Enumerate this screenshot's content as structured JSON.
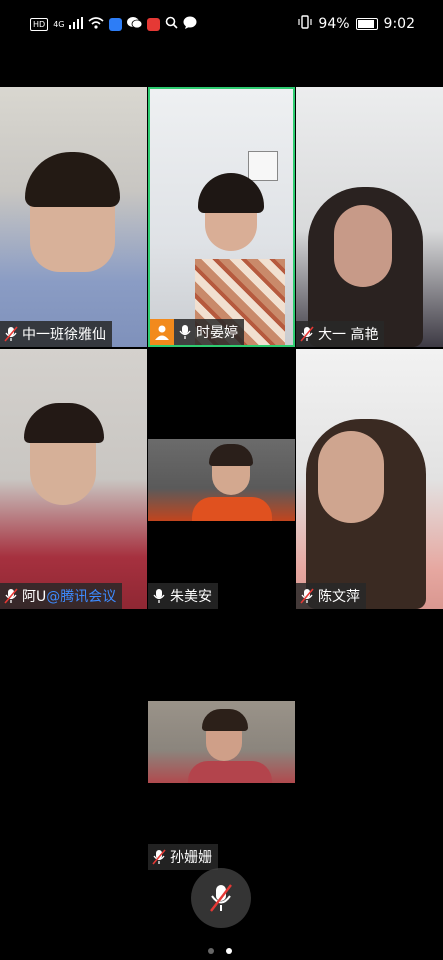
{
  "status_bar": {
    "hd": "HD",
    "net": "4G",
    "battery": "94%",
    "time": "9:02"
  },
  "participants": [
    {
      "name": "中一班徐雅仙",
      "mic": "muted"
    },
    {
      "name": "时晏婷",
      "mic": "on",
      "active_speaker": true
    },
    {
      "name": "大一 高艳",
      "mic": "muted"
    },
    {
      "name_prefix": "阿U",
      "name_suffix": "@腾讯会议",
      "mic": "muted"
    },
    {
      "name": "朱美安",
      "mic": "on"
    },
    {
      "name": "陈文萍",
      "mic": "muted"
    },
    {
      "name": "孙姗姗",
      "mic": "muted"
    }
  ],
  "controls": {
    "mute_button": "mic-off-icon"
  },
  "pagination": {
    "pages": 2,
    "current": 2
  }
}
